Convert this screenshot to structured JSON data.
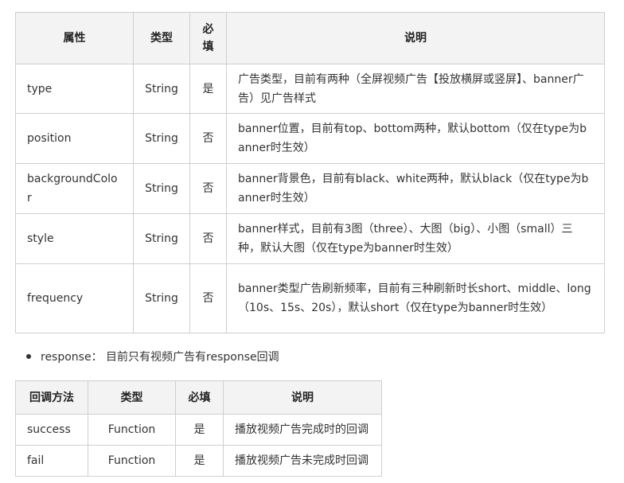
{
  "params_table": {
    "headers": {
      "property": "属性",
      "type": "类型",
      "required_line1": "必",
      "required_line2": "填",
      "desc": "说明"
    },
    "rows": [
      {
        "name": "type",
        "type": "String",
        "required": "是",
        "desc": "广告类型，目前有两种（全屏视频广告【投放横屏或竖屏】、banner广告）见广告样式"
      },
      {
        "name": "position",
        "type": "String",
        "required": "否",
        "desc": "banner位置，目前有top、bottom两种，默认bottom（仅在type为banner时生效）"
      },
      {
        "name": "backgroundColor",
        "type": "String",
        "required": "否",
        "desc": "banner背景色，目前有black、white两种，默认black（仅在type为banner时生效）"
      },
      {
        "name": "style",
        "type": "String",
        "required": "否",
        "desc": "banner样式，目前有3图（three）、大图（big）、小图（small）三种，默认大图（仅在type为banner时生效）"
      },
      {
        "name": "frequency",
        "type": "String",
        "required": "否",
        "desc": "banner类型广告刷新频率，目前有三种刷新时长short、middle、long（10s、15s、20s），默认short（仅在type为banner时生效）"
      }
    ]
  },
  "response_note": "response： 目前只有视频广告有response回调",
  "callback_table": {
    "headers": {
      "method": "回调方法",
      "type": "类型",
      "required": "必填",
      "desc": "说明"
    },
    "rows": [
      {
        "name": "success",
        "type": "Function",
        "required": "是",
        "desc": "播放视频广告完成时的回调"
      },
      {
        "name": "fail",
        "type": "Function",
        "required": "是",
        "desc": "播放视频广告未完成时回调"
      }
    ]
  }
}
